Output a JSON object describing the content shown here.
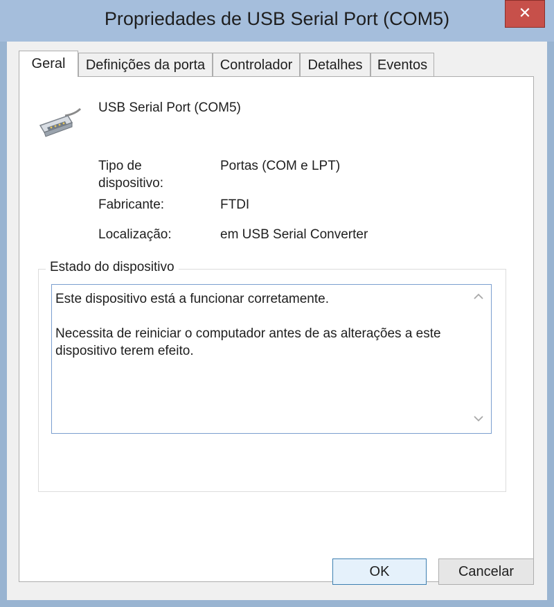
{
  "window": {
    "title": "Propriedades de USB Serial Port (COM5)",
    "close_glyph": "✕"
  },
  "tabs": [
    {
      "label": "Geral",
      "active": true
    },
    {
      "label": "Definições da porta",
      "active": false
    },
    {
      "label": "Controlador",
      "active": false
    },
    {
      "label": "Detalhes",
      "active": false
    },
    {
      "label": "Eventos",
      "active": false
    }
  ],
  "device": {
    "icon": "serial-port-connector-icon",
    "name": "USB Serial Port (COM5)"
  },
  "properties": {
    "type_label": "Tipo de dispositivo:",
    "type_value": "Portas (COM e LPT)",
    "manufacturer_label": "Fabricante:",
    "manufacturer_value": "FTDI",
    "location_label": "Localização:",
    "location_value": "em USB Serial Converter"
  },
  "status": {
    "group_label": "Estado do dispositivo",
    "line1": "Este dispositivo está a funcionar corretamente.",
    "line2": "Necessita de reiniciar o computador antes de as alterações a este dispositivo terem efeito."
  },
  "buttons": {
    "ok": "OK",
    "cancel": "Cancelar"
  },
  "colors": {
    "frame": "#99b4d1",
    "close": "#c7504a",
    "accent_border": "#7a9ecf"
  }
}
